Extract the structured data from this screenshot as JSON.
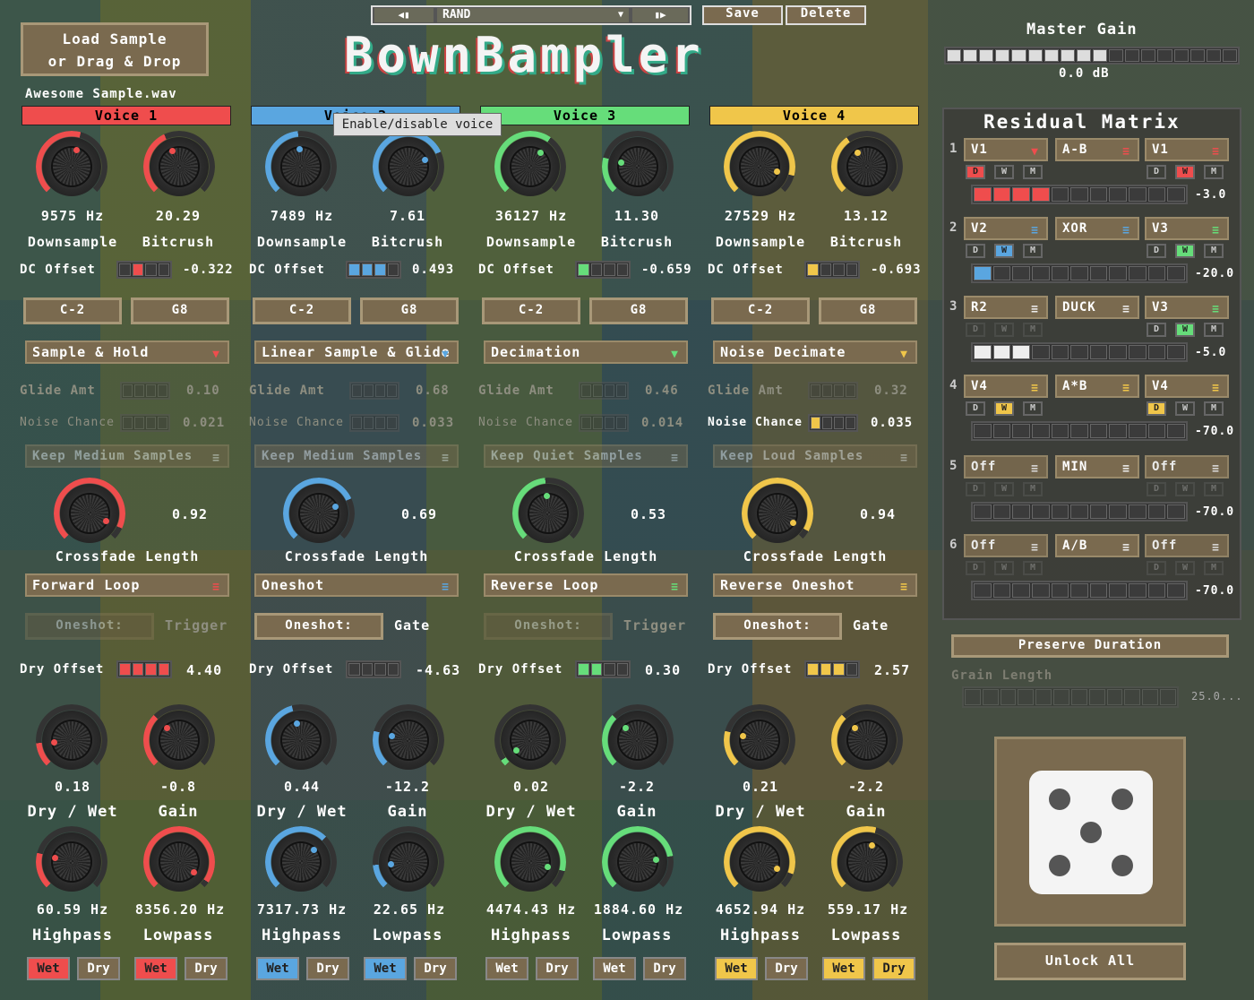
{
  "header": {
    "load_line1": "Load Sample",
    "load_line2": "or Drag & Drop",
    "filename": "Awesome Sample.wav",
    "preset_name": "RAND",
    "save": "Save",
    "delete": "Delete",
    "logo": "BownBampler",
    "master_gain_label": "Master Gain",
    "master_gain_value": "0.0 dB",
    "tooltip": "Enable/disable voice",
    "prev_icon": "prev-preset-icon",
    "next_icon": "next-preset-icon"
  },
  "colors": {
    "v1": "#ef4d4d",
    "v2": "#5aa6e0",
    "v3": "#66dd7a",
    "v4": "#f0c64a"
  },
  "voices": [
    {
      "name": "Voice 1",
      "ds": "9575 Hz",
      "bc": "20.29",
      "ds_lbl": "Downsample",
      "bc_lbl": "Bitcrush",
      "dc_lbl": "DC Offset",
      "dc": "-0.322",
      "note_lo": "C-2",
      "note_hi": "G8",
      "mode": "Sample & Hold",
      "glide_lbl": "Glide Amt",
      "glide": "0.10",
      "noise_lbl": "Noise Chance",
      "noise": "0.021",
      "keep": "Keep Medium Samples",
      "xf": "0.92",
      "xf_lbl": "Crossfade Length",
      "loop": "Forward Loop",
      "oneshot": "Oneshot:",
      "trig": "Trigger",
      "dry_lbl": "Dry Offset",
      "dry": "4.40",
      "dw": "0.18",
      "gain": "-0.8",
      "dw_lbl": "Dry / Wet",
      "gain_lbl": "Gain",
      "hp": "60.59 Hz",
      "lp": "8356.20 Hz",
      "hp_lbl": "Highpass",
      "lp_lbl": "Lowpass",
      "wet": "Wet",
      "drys": "Dry"
    },
    {
      "name": "Voice 2",
      "ds": "7489 Hz",
      "bc": "7.61",
      "ds_lbl": "Downsample",
      "bc_lbl": "Bitcrush",
      "dc_lbl": "DC Offset",
      "dc": "0.493",
      "note_lo": "C-2",
      "note_hi": "G8",
      "mode": "Linear Sample & Glide",
      "glide_lbl": "Glide Amt",
      "glide": "0.68",
      "noise_lbl": "Noise Chance",
      "noise": "0.033",
      "keep": "Keep Medium Samples",
      "xf": "0.69",
      "xf_lbl": "Crossfade Length",
      "loop": "Oneshot",
      "oneshot": "Oneshot:",
      "trig": "Gate",
      "dry_lbl": "Dry Offset",
      "dry": "-4.63",
      "dw": "0.44",
      "gain": "-12.2",
      "dw_lbl": "Dry / Wet",
      "gain_lbl": "Gain",
      "hp": "7317.73 Hz",
      "lp": "22.65 Hz",
      "hp_lbl": "Highpass",
      "lp_lbl": "Lowpass",
      "wet": "Wet",
      "drys": "Dry"
    },
    {
      "name": "Voice 3",
      "ds": "36127 Hz",
      "bc": "11.30",
      "ds_lbl": "Downsample",
      "bc_lbl": "Bitcrush",
      "dc_lbl": "DC Offset",
      "dc": "-0.659",
      "note_lo": "C-2",
      "note_hi": "G8",
      "mode": "Decimation",
      "glide_lbl": "Glide Amt",
      "glide": "0.46",
      "noise_lbl": "Noise Chance",
      "noise": "0.014",
      "keep": "Keep Quiet Samples",
      "xf": "0.53",
      "xf_lbl": "Crossfade Length",
      "loop": "Reverse Loop",
      "oneshot": "Oneshot:",
      "trig": "Trigger",
      "dry_lbl": "Dry Offset",
      "dry": "0.30",
      "dw": "0.02",
      "gain": "-2.2",
      "dw_lbl": "Dry / Wet",
      "gain_lbl": "Gain",
      "hp": "4474.43 Hz",
      "lp": "1884.60 Hz",
      "hp_lbl": "Highpass",
      "lp_lbl": "Lowpass",
      "wet": "Wet",
      "drys": "Dry"
    },
    {
      "name": "Voice 4",
      "ds": "27529 Hz",
      "bc": "13.12",
      "ds_lbl": "Downsample",
      "bc_lbl": "Bitcrush",
      "dc_lbl": "DC Offset",
      "dc": "-0.693",
      "note_lo": "C-2",
      "note_hi": "G8",
      "mode": "Noise Decimate",
      "glide_lbl": "Glide Amt",
      "glide": "0.32",
      "noise_lbl": "Noise Chance",
      "noise": "0.035",
      "keep": "Keep Loud Samples",
      "xf": "0.94",
      "xf_lbl": "Crossfade Length",
      "loop": "Reverse Oneshot",
      "oneshot": "Oneshot:",
      "trig": "Gate",
      "dry_lbl": "Dry Offset",
      "dry": "2.57",
      "dw": "0.21",
      "gain": "-2.2",
      "dw_lbl": "Dry / Wet",
      "gain_lbl": "Gain",
      "hp": "4652.94 Hz",
      "lp": "559.17 Hz",
      "hp_lbl": "Highpass",
      "lp_lbl": "Lowpass",
      "wet": "Wet",
      "drys": "Dry"
    }
  ],
  "matrix": {
    "title": "Residual Matrix",
    "rows": [
      {
        "n": "1",
        "a": "V1",
        "op": "A-B",
        "b": "V1",
        "val": "-3.0"
      },
      {
        "n": "2",
        "a": "V2",
        "op": "XOR",
        "b": "V3",
        "val": "-20.0"
      },
      {
        "n": "3",
        "a": "R2",
        "op": "DUCK",
        "b": "V3",
        "val": "-5.0"
      },
      {
        "n": "4",
        "a": "V4",
        "op": "A*B",
        "b": "V4",
        "val": "-70.0"
      },
      {
        "n": "5",
        "a": "Off",
        "op": "MIN",
        "b": "Off",
        "val": "-70.0"
      },
      {
        "n": "6",
        "a": "Off",
        "op": "A/B",
        "b": "Off",
        "val": "-70.0"
      }
    ],
    "d": "D",
    "w": "W",
    "m": "M"
  },
  "preserve": "Preserve Duration",
  "grain_lbl": "Grain Length",
  "grain_val": "25.0...",
  "dice_icon": "dice-five-icon",
  "unlock": "Unlock All"
}
